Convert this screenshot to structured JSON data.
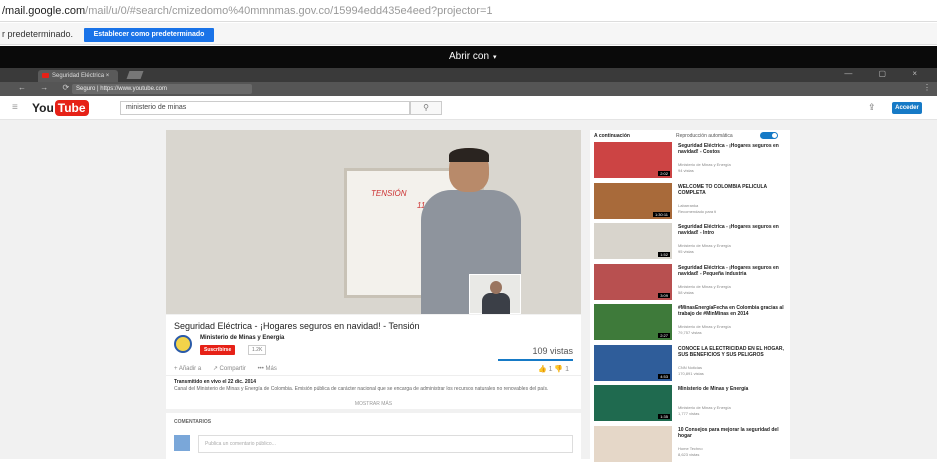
{
  "gmail": {
    "url_domain": "/mail.google.com",
    "url_path": "/mail/u/0/#search/cmizedomo%40mmnmas.gov.co/15994edd435e4eed?projector=1"
  },
  "default_bar": {
    "text": "r predeterminado.",
    "button": "Establecer como predeterminado"
  },
  "viewer": {
    "open_with": "Abrir con",
    "caret": "▾"
  },
  "browser": {
    "tab_title": "Seguridad Eléctrica",
    "tab_close": "× ",
    "window_controls": "— ▢ ×",
    "nav": "← → ⟳",
    "address": "Seguro | https://www.youtube.com",
    "menu": "⋮"
  },
  "youtube": {
    "menu_icon": "≡",
    "logo_you": "You",
    "logo_tube": "Tube",
    "search_value": "ministerio de minas",
    "search_icon": "⚲",
    "upload_icon": "⇪",
    "signin_label": "Acceder"
  },
  "video": {
    "title": "Seguridad Eléctrica - ¡Hogares seguros en navidad! - Tensión",
    "channel": "Ministerio de Minas y Energía",
    "subscribe": "Suscribirse",
    "sub_count": "1.2K",
    "views": "109 vistas",
    "actions": [
      "+ Añadir a",
      "↗ Compartir",
      "••• Más"
    ],
    "likes": "👍 1   👎 1",
    "published": "Transmitido en vivo el 22 dic. 2014",
    "description": "Canal del Ministerio de Minas y Energía de Colombia. Emisión pública de carácter nacional que se encarga de administrar los recursos naturales no renovables del país.",
    "show_more": "MOSTRAR MÁS",
    "board_text": [
      "TENSIÓN",
      "110V"
    ]
  },
  "comments": {
    "label": "COMENTARIOS",
    "placeholder": "Publica un comentario público..."
  },
  "sidebar": {
    "up_next": "A continuación",
    "autoplay": "Reproducción automática",
    "items": [
      {
        "title": "Seguridad Eléctrica - ¡Hogares seguros en navidad! - Costos",
        "channel": "Ministerio de Minas y Energía",
        "views": "94 vistas",
        "duration": "2:02",
        "color": "#c44"
      },
      {
        "title": "WELCOME TO COLOMBIA PELÍCULA COMPLETA",
        "channel": "Labarranka",
        "views": "Recomendado para ti",
        "duration": "1:30:11",
        "color": "#a86a3a"
      },
      {
        "title": "Seguridad Eléctrica - ¡Hogares seguros en navidad! - Intro",
        "channel": "Ministerio de Minas y Energía",
        "views": "95 vistas",
        "duration": "1:52",
        "color": "#d8d4cc"
      },
      {
        "title": "Seguridad Eléctrica - ¡Hogares seguros en navidad! - Pequeña industria",
        "channel": "Ministerio de Minas y Energía",
        "views": "58 vistas",
        "duration": "3:09",
        "color": "#b85050"
      },
      {
        "title": "#MinasEnergíaFecha en Colombia gracias al trabajo de #MinMinas en 2014",
        "channel": "Ministerio de Minas y Energía",
        "views": "79,757 vistas",
        "duration": "2:27",
        "color": "#3e7a3a"
      },
      {
        "title": "CONOCE LA ELECTRICIDAD EN EL HOGAR, SUS BENEFICIOS Y SUS PELIGROS",
        "channel": "CNN Noticias",
        "views": "170,891 vistas",
        "duration": "4:53",
        "color": "#2f5d9a"
      },
      {
        "title": "Ministerio de Minas y Energía",
        "channel": "Ministerio de Minas y Energía",
        "views": "1,777 vistas",
        "duration": "1:35",
        "color": "#1f6a4f"
      },
      {
        "title": "10 Consejos para mejorar la seguridad del hogar",
        "channel": "Home Techno",
        "views": "8,623 vistas",
        "duration": "",
        "color": "#e5d7c8"
      }
    ]
  }
}
